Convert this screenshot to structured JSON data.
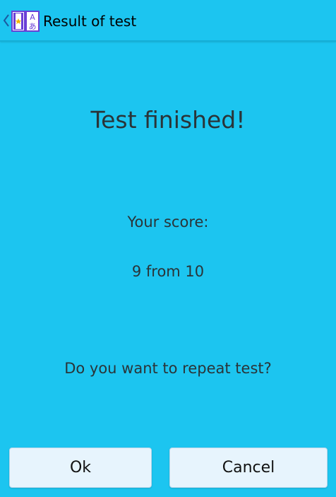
{
  "header": {
    "title": "Result of test",
    "back_icon": "chevron-left-icon",
    "app_icon": "flashcards-app-icon"
  },
  "main": {
    "headline": "Test finished!",
    "score_label": "Your score:",
    "score_value": "9 from 10",
    "repeat_question": "Do you want to repeat test?"
  },
  "actions": {
    "ok_label": "Ok",
    "cancel_label": "Cancel"
  },
  "colors": {
    "background": "#1cc5f0",
    "button_background": "#e7f4fd",
    "text": "#2a3438",
    "app_icon_accent": "#6a3fd6"
  }
}
